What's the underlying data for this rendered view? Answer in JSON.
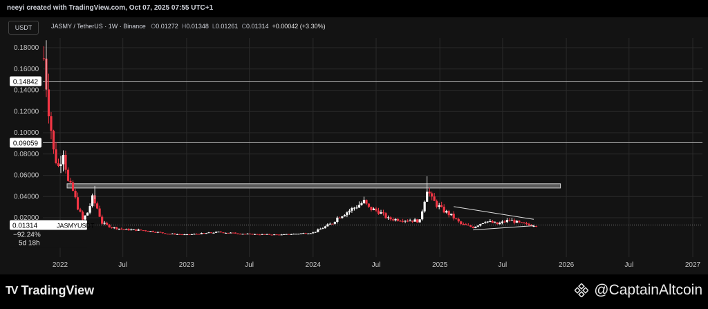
{
  "header": {
    "credit": "neeyi created with TradingView.com, Oct 07, 2025 07:55 UTC+1",
    "currency_button": "USDT",
    "symbol": "JASMY / TetherUS · 1W · Binance",
    "ohlc": {
      "o_label": "O",
      "o": "0.01272",
      "h_label": "H",
      "h": "0.01348",
      "l_label": "L",
      "l": "0.01261",
      "c_label": "C",
      "c": "0.01314",
      "change": "+0.00042 (+3.30%)"
    }
  },
  "price_tag": {
    "price": "0.01314",
    "symbol": "JASMYUSDT",
    "change": "−92.24%",
    "countdown": "5d 18h"
  },
  "levels": {
    "upper": "0.14842",
    "lower": "0.09059"
  },
  "footer": {
    "tv_logo": "TradingView",
    "brand": "@CaptainAltcoin"
  },
  "colors": {
    "up": "#ffffff",
    "down": "#f23645",
    "grid": "#2a2a2a",
    "level": "#b0b0b0",
    "zone_fill": "#5a5a5a",
    "zone_stroke": "#cfcfcf"
  },
  "chart_data": {
    "type": "candlestick",
    "title": "JASMY / TetherUS · 1W · Binance",
    "ylim": [
      0,
      0.19
    ],
    "y_ticks": [
      "0.18000",
      "0.16000",
      "0.14000",
      "0.12000",
      "0.10000",
      "0.08000",
      "0.06000",
      "0.04000",
      "0.02000"
    ],
    "y_tick_values": [
      0.18,
      0.16,
      0.14,
      0.12,
      0.1,
      0.08,
      0.06,
      0.04,
      0.02
    ],
    "x_ticks": [
      "2022",
      "Jul",
      "2023",
      "Jul",
      "2024",
      "Jul",
      "2025",
      "Jul",
      "2026",
      "Jul",
      "2027"
    ],
    "x_tick_dates": [
      "2022-01-01",
      "2022-07-01",
      "2023-01-01",
      "2023-07-01",
      "2024-01-01",
      "2024-07-01",
      "2025-01-01",
      "2025-07-01",
      "2026-01-01",
      "2026-07-01",
      "2027-01-01"
    ],
    "horizontal_levels": [
      0.14842,
      0.09059
    ],
    "resistance_zone": {
      "from": 0.048,
      "to": 0.052,
      "start": "2022-01-21",
      "end": "2025-12-15"
    },
    "triangle": {
      "upper_start": [
        "2025-02-10",
        0.0305
      ],
      "upper_end": [
        "2025-09-29",
        0.0185
      ],
      "lower_start": [
        "2025-04-07",
        0.0085
      ],
      "lower_end": [
        "2025-09-29",
        0.0125
      ]
    },
    "current_price": 0.01314,
    "last_bar": {
      "open": 0.01272,
      "high": 0.01348,
      "low": 0.01261,
      "close": 0.01314
    },
    "approx_closes": [
      [
        "2021-11-15",
        0.17
      ],
      [
        "2021-11-29",
        0.125
      ],
      [
        "2021-12-13",
        0.082
      ],
      [
        "2021-12-27",
        0.068
      ],
      [
        "2022-01-10",
        0.085
      ],
      [
        "2022-01-24",
        0.053
      ],
      [
        "2022-02-07",
        0.045
      ],
      [
        "2022-02-21",
        0.03
      ],
      [
        "2022-03-07",
        0.018
      ],
      [
        "2022-03-21",
        0.025
      ],
      [
        "2022-04-04",
        0.038
      ],
      [
        "2022-04-18",
        0.029
      ],
      [
        "2022-05-02",
        0.015
      ],
      [
        "2022-05-30",
        0.011
      ],
      [
        "2022-07-04",
        0.009
      ],
      [
        "2022-09-05",
        0.008
      ],
      [
        "2022-11-07",
        0.005
      ],
      [
        "2023-01-02",
        0.004
      ],
      [
        "2023-04-03",
        0.0065
      ],
      [
        "2023-07-03",
        0.0045
      ],
      [
        "2023-10-02",
        0.004
      ],
      [
        "2024-01-01",
        0.006
      ],
      [
        "2024-02-26",
        0.015
      ],
      [
        "2024-03-11",
        0.02
      ],
      [
        "2024-05-27",
        0.035
      ],
      [
        "2024-06-10",
        0.029
      ],
      [
        "2024-07-08",
        0.026
      ],
      [
        "2024-08-05",
        0.019
      ],
      [
        "2024-11-04",
        0.017
      ],
      [
        "2024-11-25",
        0.048
      ],
      [
        "2024-12-09",
        0.037
      ],
      [
        "2025-01-06",
        0.028
      ],
      [
        "2025-02-03",
        0.022
      ],
      [
        "2025-03-03",
        0.014
      ],
      [
        "2025-04-07",
        0.011
      ],
      [
        "2025-05-12",
        0.017
      ],
      [
        "2025-06-16",
        0.014
      ],
      [
        "2025-07-21",
        0.018
      ],
      [
        "2025-08-18",
        0.015
      ],
      [
        "2025-09-15",
        0.013
      ],
      [
        "2025-10-06",
        0.01314
      ]
    ]
  }
}
